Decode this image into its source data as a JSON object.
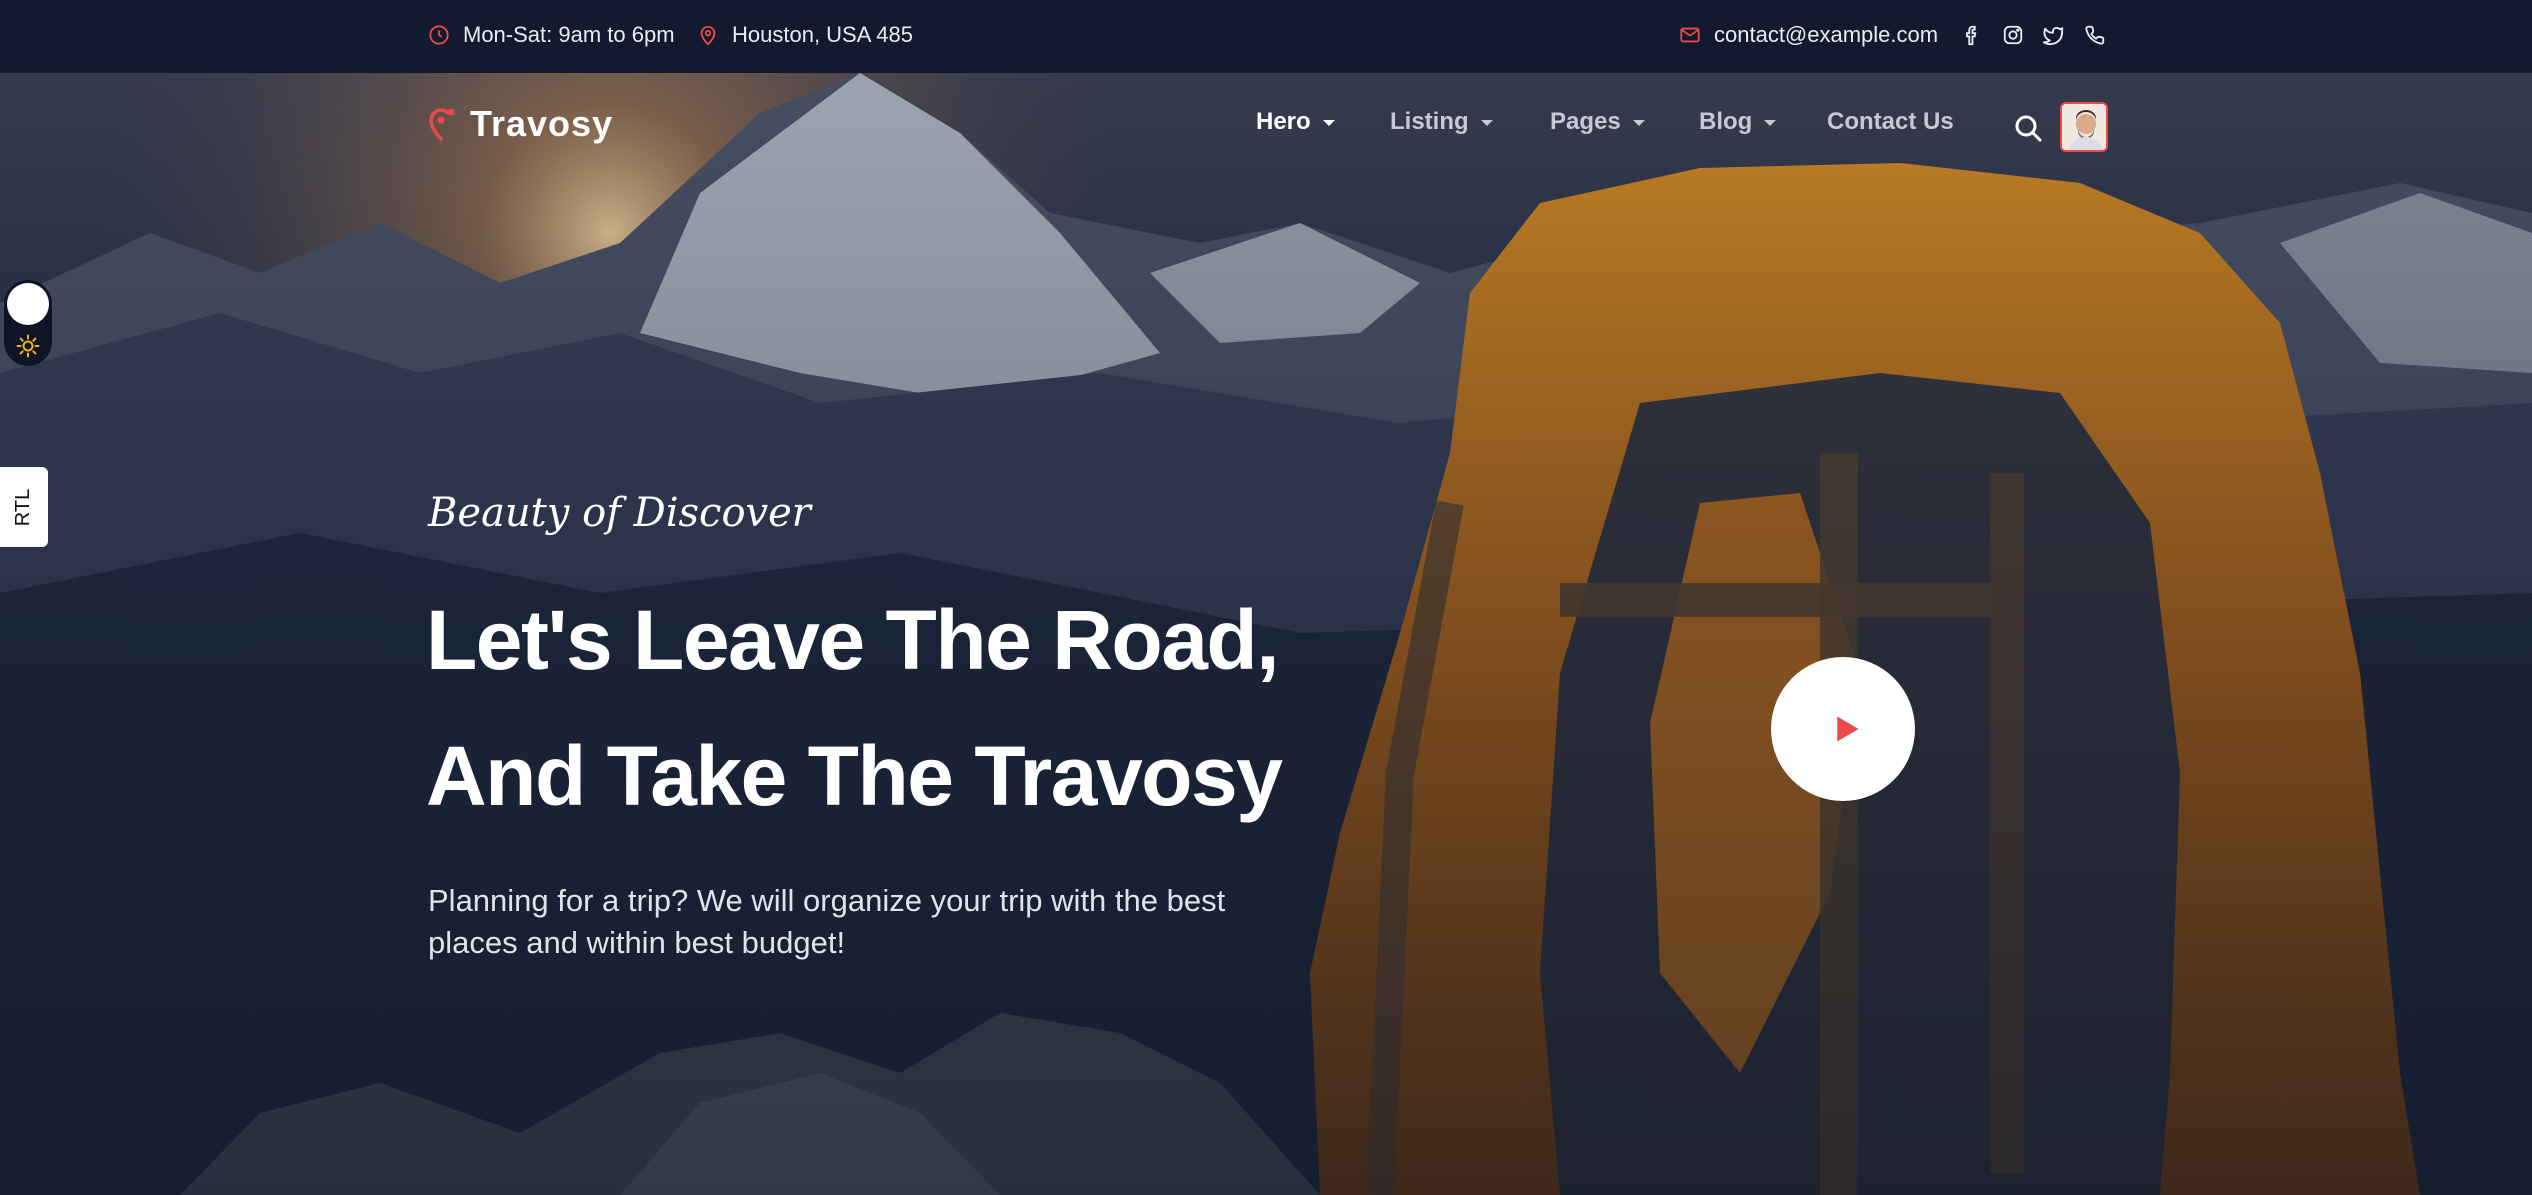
{
  "topbar": {
    "hours": "Mon-Sat: 9am to 6pm",
    "location": "Houston, USA 485",
    "email": "contact@example.com",
    "social_icons": [
      "facebook-icon",
      "instagram-icon",
      "twitter-icon",
      "phone-icon"
    ]
  },
  "brand": {
    "name": "Travosy",
    "accent": "#e94a4a",
    "topbar_bg": "#111a2e"
  },
  "nav": {
    "items": [
      {
        "label": "Hero",
        "has_dropdown": true,
        "active": true
      },
      {
        "label": "Listing",
        "has_dropdown": true
      },
      {
        "label": "Pages",
        "has_dropdown": true
      },
      {
        "label": "Blog",
        "has_dropdown": true
      },
      {
        "label": "Contact Us",
        "has_dropdown": false
      }
    ]
  },
  "side": {
    "rtl_label": "RTL",
    "theme_icon": "sun-icon"
  },
  "hero": {
    "eyebrow": "Beauty of Discover",
    "headline_line1": "Let's Leave The Road,",
    "headline_line2": "And Take The Travosy",
    "description": "Planning for a trip? We will organize your trip with the best places and within best budget!",
    "play_icon": "play-icon"
  }
}
